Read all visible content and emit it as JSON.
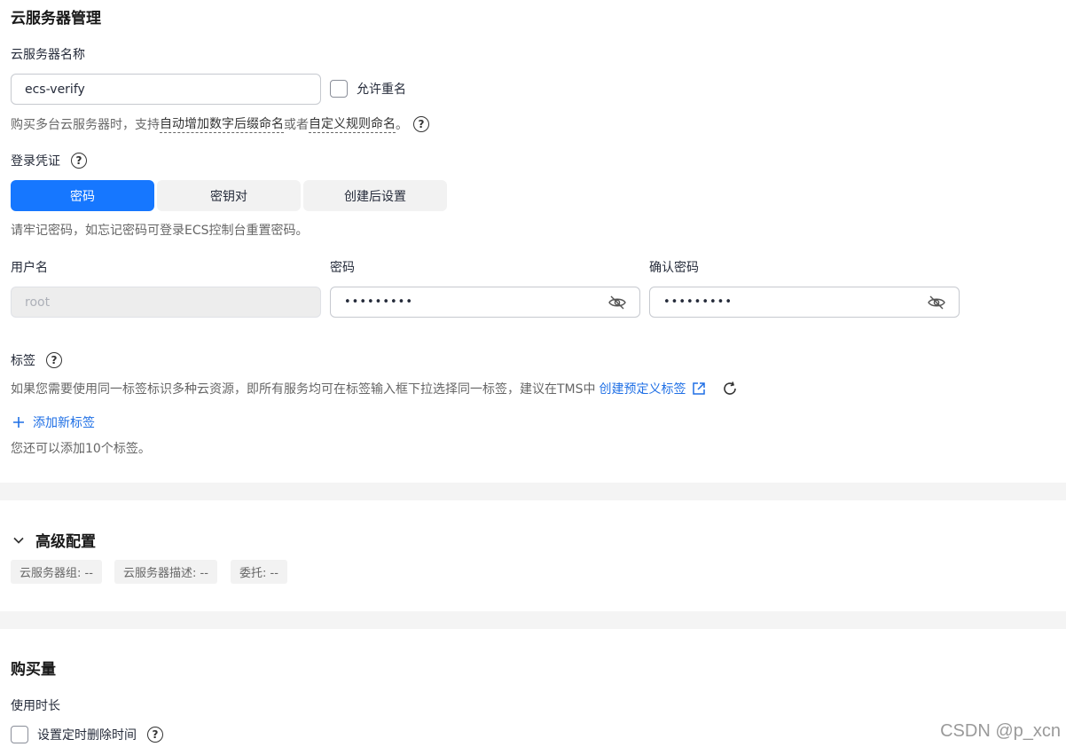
{
  "server_mgmt": {
    "title": "云服务器管理",
    "name_label": "云服务器名称",
    "name_value": "ecs-verify",
    "allow_duplicate_label": "允许重名",
    "naming_hint_prefix": "购买多台云服务器时，支持",
    "naming_hint_link1": "自动增加数字后缀命名",
    "naming_hint_mid": "或者",
    "naming_hint_link2": "自定义规则命名",
    "naming_hint_suffix": "。"
  },
  "credentials": {
    "label": "登录凭证",
    "tabs": [
      {
        "label": "密码",
        "active": true
      },
      {
        "label": "密钥对",
        "active": false
      },
      {
        "label": "创建后设置",
        "active": false
      }
    ],
    "hint": "请牢记密码，如忘记密码可登录ECS控制台重置密码。",
    "username_label": "用户名",
    "username_value": "root",
    "password_label": "密码",
    "password_value": "•••••••••",
    "confirm_label": "确认密码",
    "confirm_value": "•••••••••"
  },
  "tags": {
    "label": "标签",
    "hint_text": "如果您需要使用同一标签标识多种云资源，即所有服务均可在标签输入框下拉选择同一标签，建议在TMS中",
    "create_link": "创建预定义标签",
    "add_tag": "添加新标签",
    "remaining": "您还可以添加10个标签。"
  },
  "advanced": {
    "title": "高级配置",
    "chips": [
      "云服务器组: --",
      "云服务器描述: --",
      "委托: --"
    ]
  },
  "purchase": {
    "title": "购买量",
    "duration_label": "使用时长",
    "schedule_delete_label": "设置定时删除时间"
  },
  "watermark": "CSDN @p_xcn",
  "colors": {
    "accent": "#1677ff",
    "link": "#1f6fe5"
  }
}
